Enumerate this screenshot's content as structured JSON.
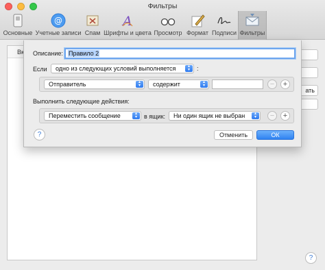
{
  "window": {
    "title": "Фильтры"
  },
  "toolbar": {
    "tabs": [
      {
        "label": "Основные",
        "icon": "general-switch-icon",
        "active": false
      },
      {
        "label": "Учетные записи",
        "icon": "at-sign-icon",
        "active": false
      },
      {
        "label": "Спам",
        "icon": "junk-tray-icon",
        "active": false
      },
      {
        "label": "Шрифты и цвета",
        "icon": "fonts-colors-icon",
        "active": false
      },
      {
        "label": "Просмотр",
        "icon": "glasses-icon",
        "active": false
      },
      {
        "label": "Формат",
        "icon": "pen-paper-icon",
        "active": false
      },
      {
        "label": "Подписи",
        "icon": "signature-icon",
        "active": false
      },
      {
        "label": "Фильтры",
        "icon": "rules-envelope-icon",
        "active": true
      }
    ]
  },
  "background": {
    "header_text": "Вк",
    "side_button_partial": "ать"
  },
  "sheet": {
    "description_label": "Описание:",
    "description_value": "Правило 2",
    "if_label": "Если",
    "condition_mode": "одно из следующих условий выполняется",
    "condition_colon": ":",
    "condition": {
      "field": "Отправитель",
      "operator": "содержит",
      "value": ""
    },
    "actions_label": "Выполнить следующие действия:",
    "action": {
      "type": "Переместить сообщение",
      "to_label": "в ящик:",
      "mailbox": "Ни один ящик не выбран"
    },
    "help": "?",
    "cancel_label": "Отменить",
    "ok_label": "ОК",
    "remove_symbol": "−",
    "add_symbol": "+"
  },
  "footer": {
    "help": "?"
  },
  "colors": {
    "accent": "#2f82f1",
    "focus_ring": "#6ea6ee",
    "selection": "#b5d3fb"
  }
}
